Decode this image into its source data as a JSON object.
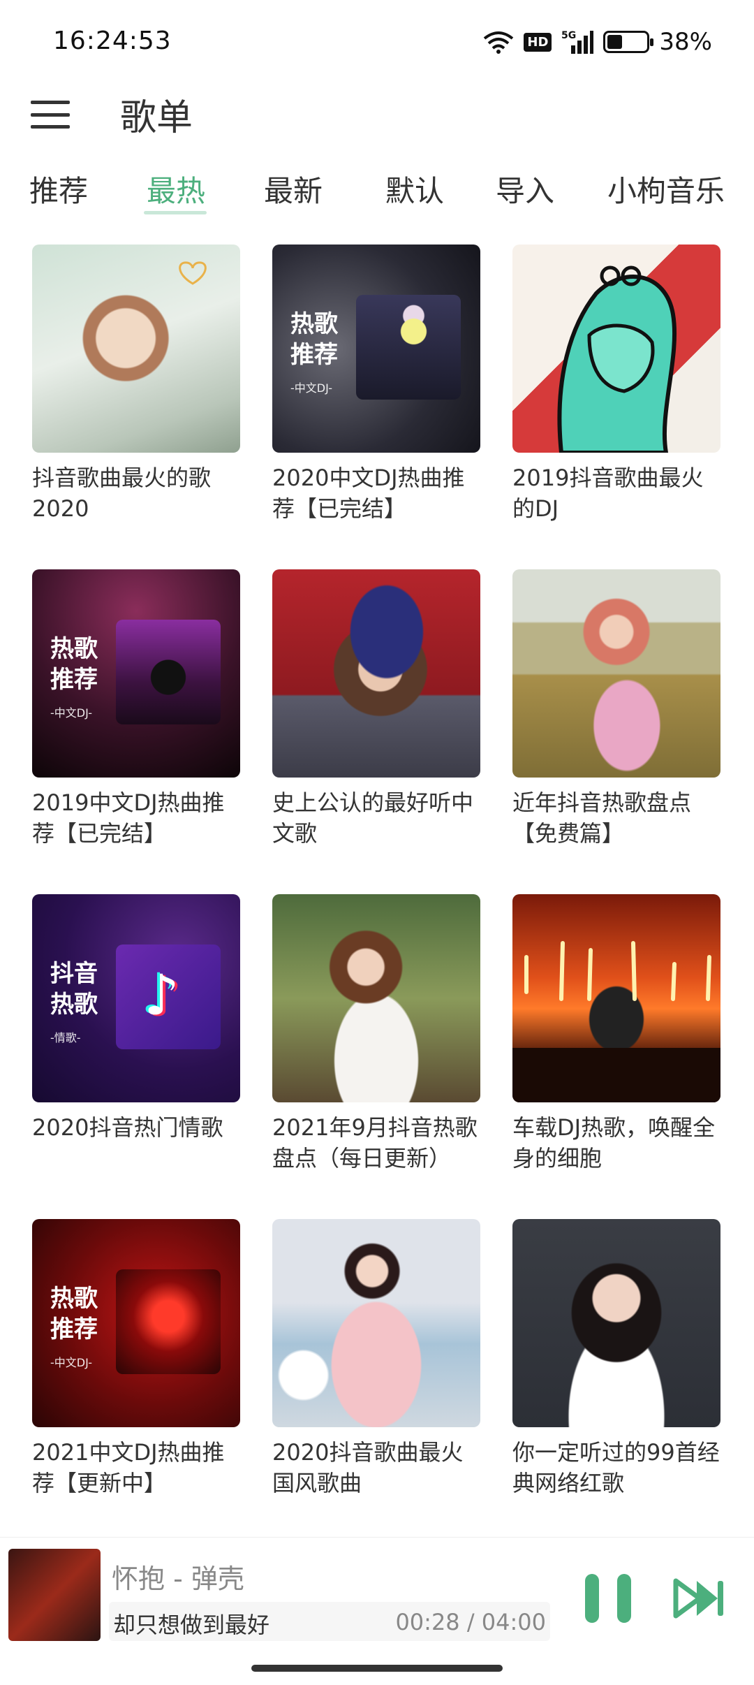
{
  "status_bar": {
    "time": "16:24:53",
    "hd_badge": "HD",
    "network": "5G",
    "battery_percent": "38%",
    "battery_level": 0.38
  },
  "header": {
    "title": "歌单"
  },
  "tabs": [
    {
      "label": "推荐",
      "active": false
    },
    {
      "label": "最热",
      "active": true
    },
    {
      "label": "最新",
      "active": false
    },
    {
      "label": "默认",
      "active": false
    },
    {
      "label": "导入",
      "active": false
    },
    {
      "label": "小枸音乐",
      "active": false
    }
  ],
  "playlists": [
    {
      "title": "抖音歌曲最火的歌2020"
    },
    {
      "title": "2020中文DJ热曲推荐【已完结】",
      "cover_badge": "热歌推荐",
      "cover_sub": "-中文DJ-"
    },
    {
      "title": "2019抖音歌曲最火的DJ"
    },
    {
      "title": "2019中文DJ热曲推荐【已完结】",
      "cover_badge": "热歌推荐",
      "cover_sub": "-中文DJ-"
    },
    {
      "title": "史上公认的最好听中文歌"
    },
    {
      "title": "近年抖音热歌盘点【免费篇】"
    },
    {
      "title": "2020抖音热门情歌",
      "cover_badge": "抖音热歌",
      "cover_sub": "-情歌-"
    },
    {
      "title": "2021年9月抖音热歌盘点（每日更新）"
    },
    {
      "title": "车载DJ热歌，唤醒全身的细胞"
    },
    {
      "title": "2021中文DJ热曲推荐【更新中】",
      "cover_badge": "热歌推荐",
      "cover_sub": "-中文DJ-"
    },
    {
      "title": "2020抖音歌曲最火国风歌曲"
    },
    {
      "title": "你一定听过的99首经典网络红歌"
    }
  ],
  "player": {
    "song": "怀抱 - 弹壳",
    "lyric": "却只想做到最好",
    "time": "00:28 / 04:00"
  },
  "colors": {
    "accent": "#4caf7d"
  }
}
